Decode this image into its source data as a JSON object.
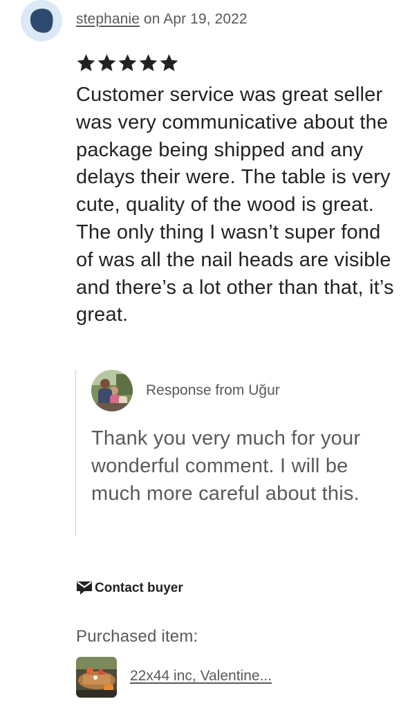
{
  "review": {
    "username": "stephanie",
    "date_text": "on Apr 19, 2022",
    "rating": 5,
    "stars_max": 5,
    "text": "Customer service was great seller was very communicative about the package being shipped and any delays their were. The table is very cute, quality of the wood is great. The only thing I wasn’t super fond of was all the nail heads are visible and there’s a lot other than that, it’s great."
  },
  "response": {
    "from_label": "Response from Uğur",
    "text": "Thank you very much for your wonderful comment. I will be much more careful about this."
  },
  "actions": {
    "contact_label": "Contact buyer",
    "contact_icon": "envelope-icon"
  },
  "purchased": {
    "label": "Purchased item:",
    "item_title": "22x44 inc, Valentine..."
  },
  "colors": {
    "avatar_bg": "#dbe8f6",
    "avatar_blob": "#2e4a6e",
    "star": "#222222",
    "muted_text": "#595959"
  }
}
